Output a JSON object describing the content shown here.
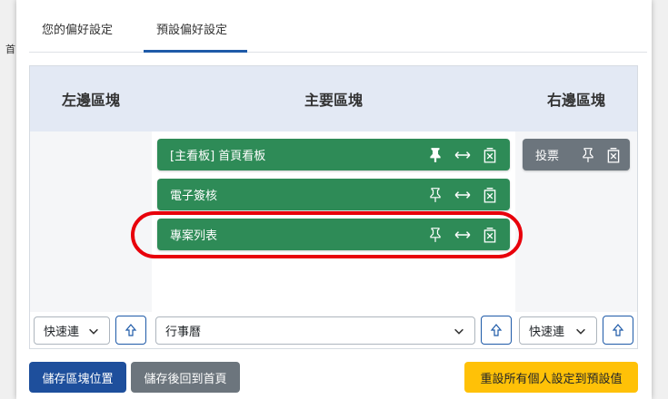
{
  "background": {
    "left_char": "首"
  },
  "tabs": [
    {
      "label": "您的偏好設定"
    },
    {
      "label": "預設偏好設定"
    }
  ],
  "columns": {
    "left": {
      "title": "左邊區塊"
    },
    "main": {
      "title": "主要區塊"
    },
    "right": {
      "title": "右邊區塊"
    }
  },
  "main_blocks": [
    {
      "label": "[主看板] 首頁看板",
      "pinned": true
    },
    {
      "label": "電子簽核",
      "pinned": false
    },
    {
      "label": "專案列表",
      "pinned": false
    }
  ],
  "right_blocks": [
    {
      "label": "投票",
      "pinned": false
    }
  ],
  "selects": {
    "left": {
      "value": "快速連"
    },
    "main": {
      "value": "行事曆"
    },
    "right": {
      "value": "快速連"
    }
  },
  "buttons": {
    "save_positions": "儲存區塊位置",
    "save_return_home": "儲存後回到首頁",
    "reset_defaults": "重設所有個人設定到預設值"
  },
  "colors": {
    "block_green": "#2e8b57",
    "block_gray": "#6c757d",
    "primary": "#1e4f9c",
    "warning": "#ffc107",
    "highlight": "#e8000b",
    "header_bg": "#e3e9f4"
  }
}
